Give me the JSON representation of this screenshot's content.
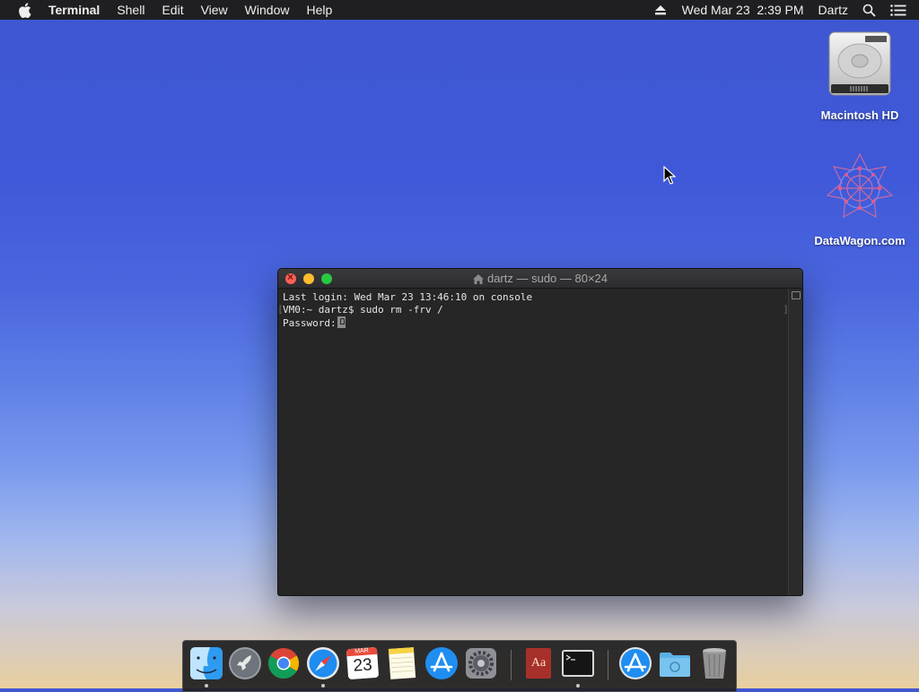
{
  "menubar": {
    "apple_icon": "apple-icon",
    "app_name": "Terminal",
    "menus": [
      "Shell",
      "Edit",
      "View",
      "Window",
      "Help"
    ],
    "clock": "Wed Mar 23  2:39 PM",
    "user": "Dartz",
    "status_icons": [
      "eject-icon",
      "search-icon",
      "notification-center-icon"
    ]
  },
  "desktop": {
    "icons": [
      {
        "label": "Macintosh HD",
        "icon": "hard-drive-icon"
      },
      {
        "label": "DataWagon.com",
        "icon": "network-volume-icon"
      }
    ]
  },
  "terminal": {
    "title": "dartz — sudo — 80×24",
    "lines": [
      "Last login: Wed Mar 23 13:46:10 on console",
      "VM0:~ dartz$ sudo rm -frv /",
      "Password:"
    ]
  },
  "dock": {
    "calendar_month": "MAR",
    "calendar_day": "23",
    "dictionary_label": "Aa",
    "items": [
      {
        "name": "Finder",
        "icon": "finder-icon",
        "running": true
      },
      {
        "name": "Launchpad",
        "icon": "launchpad-icon",
        "running": false
      },
      {
        "name": "Google Chrome",
        "icon": "chrome-icon",
        "running": false
      },
      {
        "name": "Safari",
        "icon": "safari-icon",
        "running": true
      },
      {
        "name": "Calendar",
        "icon": "calendar-icon",
        "running": false
      },
      {
        "name": "Notes",
        "icon": "notes-icon",
        "running": false
      },
      {
        "name": "App Store",
        "icon": "app-store-icon",
        "running": false
      },
      {
        "name": "System Preferences",
        "icon": "system-preferences-icon",
        "running": false
      },
      {
        "name": "Dictionary",
        "icon": "dictionary-icon",
        "running": false
      },
      {
        "name": "Terminal",
        "icon": "terminal-icon",
        "running": true
      },
      {
        "name": "Applications",
        "icon": "applications-folder-icon",
        "running": false
      },
      {
        "name": "Downloads",
        "icon": "downloads-folder-icon",
        "running": false
      },
      {
        "name": "Trash",
        "icon": "trash-icon",
        "running": false
      }
    ]
  },
  "colors": {
    "menubar_bg": "#1f1f21",
    "terminal_bg": "#262626",
    "close": "#ff5f57",
    "minimize": "#febc2e",
    "zoom": "#28c840"
  }
}
